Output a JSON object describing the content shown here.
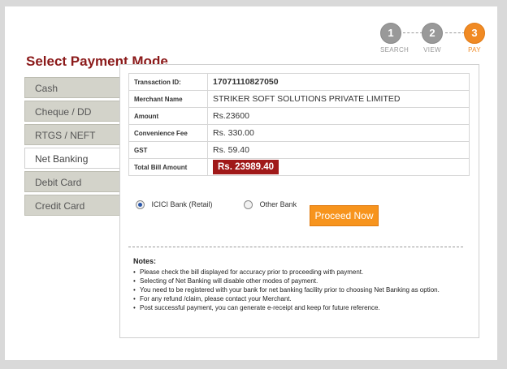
{
  "stepper": {
    "steps": [
      {
        "number": "1",
        "label": "SEARCH"
      },
      {
        "number": "2",
        "label": "VIEW"
      },
      {
        "number": "3",
        "label": "PAY"
      }
    ]
  },
  "page_title": "Select Payment Mode",
  "sidebar": {
    "items": [
      {
        "label": "Cash"
      },
      {
        "label": "Cheque / DD"
      },
      {
        "label": "RTGS / NEFT"
      },
      {
        "label": "Net Banking"
      },
      {
        "label": "Debit Card"
      },
      {
        "label": "Credit Card"
      }
    ],
    "active": "Net Banking"
  },
  "bill": {
    "rows": [
      {
        "key": "Transaction ID:",
        "value": "17071110827050"
      },
      {
        "key": "Merchant Name",
        "value": "STRIKER SOFT SOLUTIONS PRIVATE LIMITED"
      },
      {
        "key": "Amount",
        "value": "Rs.23600"
      },
      {
        "key": "Convenience Fee",
        "value": "Rs. 330.00"
      },
      {
        "key": "GST",
        "value": "Rs. 59.40"
      },
      {
        "key": "Total Bill Amount",
        "value": "Rs. 23989.40"
      }
    ]
  },
  "bank_options": {
    "option1": "ICICI Bank (Retail)",
    "option2": "Other Bank",
    "selected": "ICICI Bank (Retail)"
  },
  "proceed_label": "Proceed Now",
  "notes": {
    "title": "Notes:",
    "items": [
      "Please check the bill displayed for accuracy prior to proceeding with payment.",
      "Selecting of Net Banking will disable other modes of payment.",
      "You need to be registered with your bank for net banking facility prior to choosing Net Banking as option.",
      "For any refund /claim, please contact your Merchant.",
      "Post successful payment, you can generate e-receipt and keep for future reference."
    ]
  },
  "colors": {
    "accent": "#f08a24",
    "title": "#8b1a1a",
    "total_badge": "#a01919"
  }
}
